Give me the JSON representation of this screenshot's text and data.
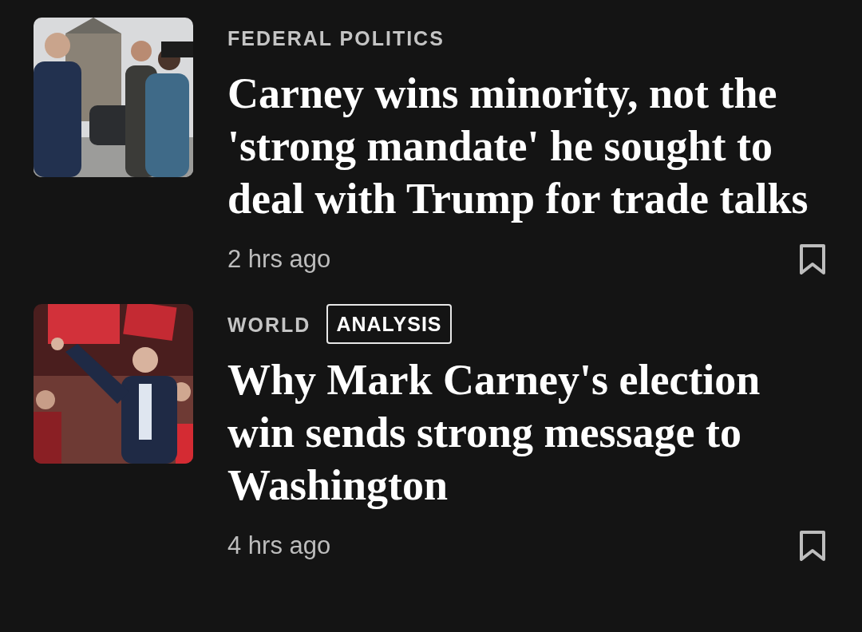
{
  "articles": [
    {
      "category": "FEDERAL POLITICS",
      "headline": "Carney wins minority, not the 'strong mandate' he sought to deal with Trump for trade talks",
      "time": "2 hrs ago",
      "bookmarked": false,
      "kind": "picture"
    },
    {
      "category": "WORLD",
      "tag": "ANALYSIS",
      "headline": "Why Mark Carney's election win sends strong message to Washington",
      "time": "4 hrs ago",
      "bookmarked": false,
      "kind": "picture"
    }
  ]
}
